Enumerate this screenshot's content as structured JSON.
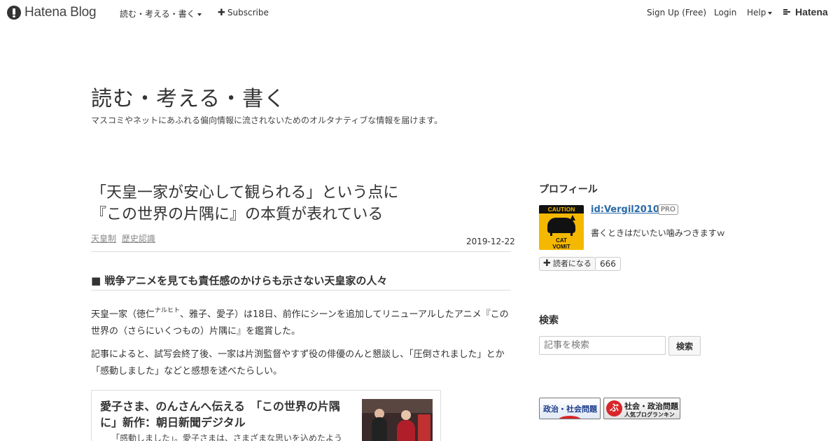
{
  "global_header": {
    "brand": "Hatena Blog",
    "blog_menu": "読む・考える・書く",
    "subscribe": "Subscribe",
    "signup": "Sign Up (Free)",
    "login": "Login",
    "help": "Help",
    "hatena": "Hatena"
  },
  "blog": {
    "title": "読む・考える・書く",
    "description": "マスコミやネットにあふれる偏向情報に流されないためのオルタナティブな情報を届けます。"
  },
  "entry": {
    "title_line1": "「天皇一家が安心して観られる」という点に",
    "title_line2": "『この世界の片隅に』の本質が表れている",
    "categories": [
      "天皇制",
      "歴史認識"
    ],
    "date": "2019-12-22",
    "heading": "■ 戦争アニメを見ても責任感のかけらも示さない天皇家の人々",
    "p1_a": "天皇一家（徳仁",
    "p1_ruby": "ナルヒト",
    "p1_b": "、雅子、愛子）は18日、前作にシーンを追加してリニューアルしたアニメ『この世界の（さらにいくつもの）片隅に』を鑑賞した。",
    "p2": "記事によると、試写会終了後、一家は片渕監督やすず役の俳優のんと懇談し、「圧倒されました」とか「感動しました」などと感想を述べたらしい。",
    "card_title": "愛子さま、のんさんへ伝える　「この世界の片隅に」新作：朝日新聞デジタル",
    "card_snippet": "「感動しました」。愛子さまは、さまざまな思いを込めたよう"
  },
  "sidebar": {
    "profile_heading": "プロフィール",
    "avatar_caution": "CAUTION",
    "avatar_text_1": "CAT",
    "avatar_text_2": "VOMIT",
    "user_id": "id:Vergil2010",
    "pro_badge": "PRO",
    "profile_desc": "書くときはだいたい噛みつきますｗ",
    "reader_button": "読者になる",
    "reader_count": "666",
    "search_heading": "検索",
    "search_placeholder": "記事を検索",
    "search_button": "検索",
    "banner1_text": "政治・社会問題",
    "banner2_mark": "ぶ",
    "banner2_text": "社会・政治問題",
    "banner2_sub": "人気ブログランキング"
  }
}
